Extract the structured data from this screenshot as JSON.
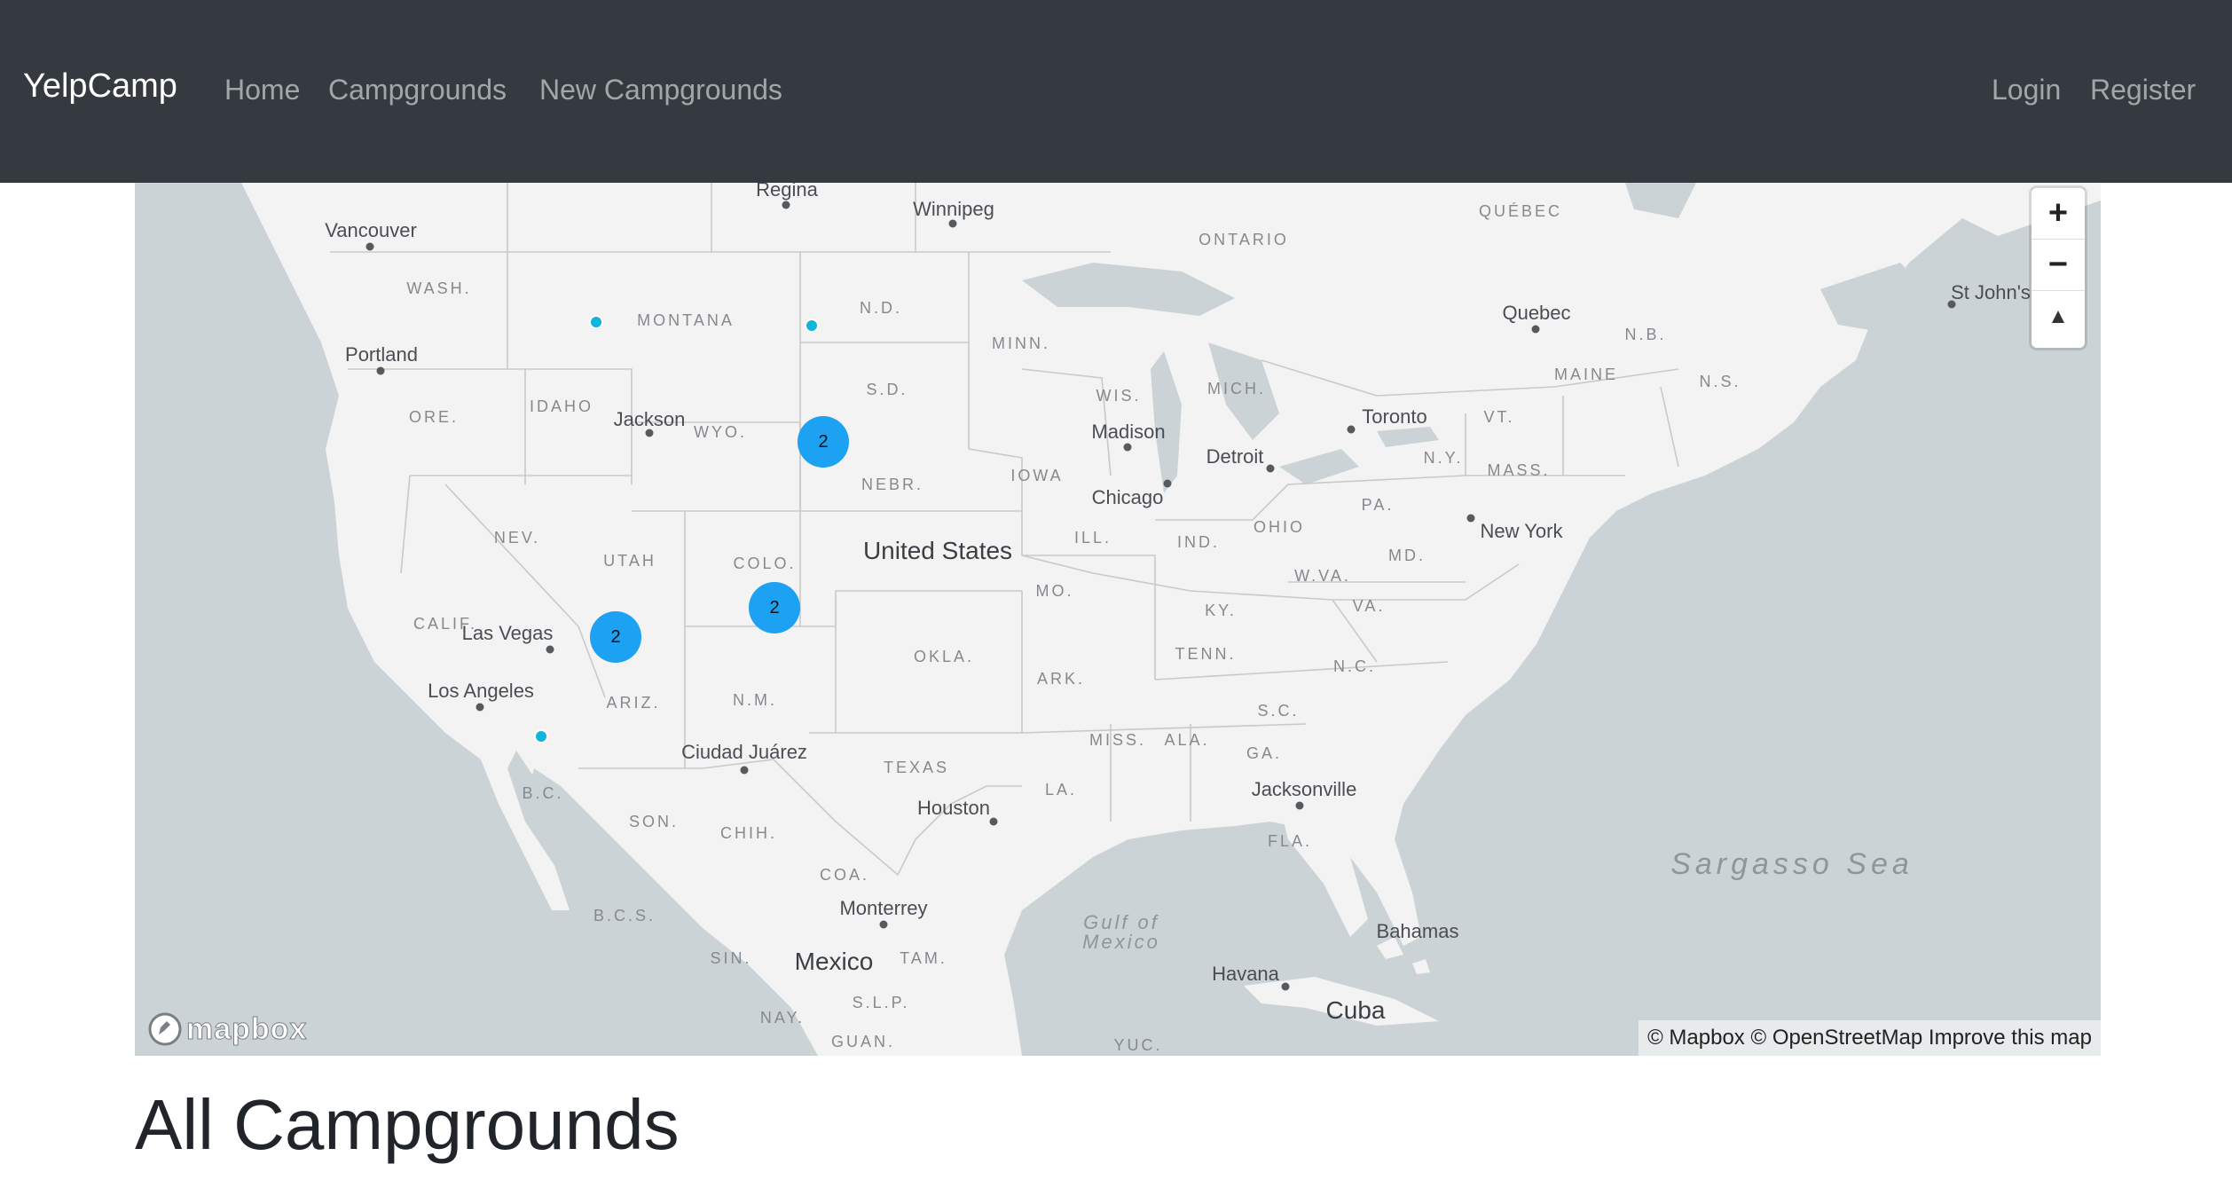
{
  "navbar": {
    "brand": "YelpCamp",
    "links": [
      "Home",
      "Campgrounds",
      "New Campgrounds"
    ],
    "auth": [
      "Login",
      "Register"
    ]
  },
  "map": {
    "zoom_in": "+",
    "zoom_out": "−",
    "compass": "▲",
    "logo": "mapbox",
    "attribution": {
      "mapbox": "© Mapbox",
      "osm": "© OpenStreetMap",
      "improve": "Improve this map"
    },
    "countries": [
      "United States",
      "Mexico",
      "Cuba"
    ],
    "seas": [
      "Sargasso Sea",
      "Gulf of Mexico"
    ],
    "cities": [
      "Regina",
      "Winnipeg",
      "Vancouver",
      "Portland",
      "Jackson",
      "Madison",
      "Detroit",
      "Toronto",
      "Chicago",
      "Quebec",
      "St John's",
      "New York",
      "Las Vegas",
      "Los Angeles",
      "Ciudad Juárez",
      "Houston",
      "Jacksonville",
      "Monterrey",
      "Havana",
      "Bahamas"
    ],
    "regions": [
      "ONTARIO",
      "QUÉBEC",
      "WASH.",
      "MONTANA",
      "N.D.",
      "MINN.",
      "WIS.",
      "MICH.",
      "N.B.",
      "MAINE",
      "N.S.",
      "ORE.",
      "IDAHO",
      "WYO.",
      "S.D.",
      "IOWA",
      "NEBR.",
      "VT.",
      "N.Y.",
      "MASS.",
      "PA.",
      "NEV.",
      "UTAH",
      "COLO.",
      "ILL.",
      "IND.",
      "OHIO",
      "MD.",
      "W.VA.",
      "MO.",
      "VA.",
      "CALIF.",
      "KY.",
      "OKLA.",
      "TENN.",
      "N.C.",
      "ARK.",
      "ARIZ.",
      "N.M.",
      "S.C.",
      "MISS.",
      "ALA.",
      "GA.",
      "TEXAS",
      "LA.",
      "B.C.",
      "SON.",
      "CHIH.",
      "FLA.",
      "COA.",
      "B.C.S.",
      "SIN.",
      "TAM.",
      "S.L.P.",
      "NAY.",
      "GUAN.",
      "YUC."
    ],
    "clusters": [
      "2",
      "2",
      "2"
    ]
  },
  "main": {
    "title": "All Campgrounds"
  }
}
